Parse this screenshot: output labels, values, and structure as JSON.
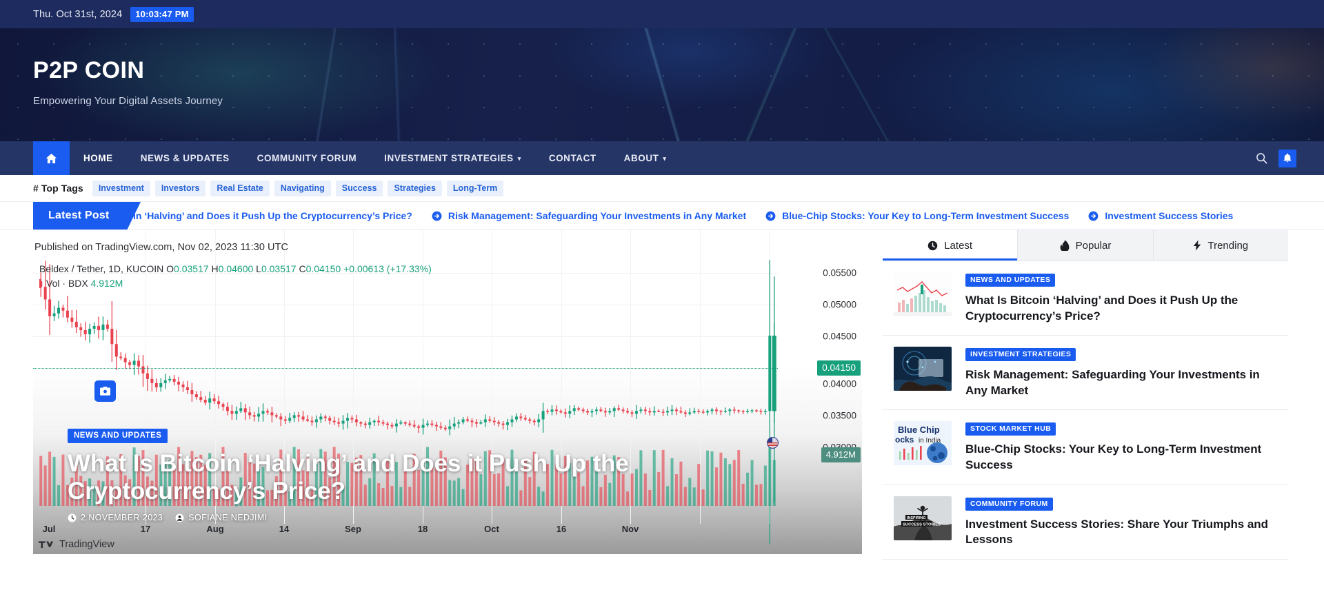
{
  "topbar": {
    "date": "Thu. Oct 31st, 2024",
    "time": "10:03:47 PM"
  },
  "banner": {
    "site_title": "P2P COIN",
    "tagline": "Empowering Your Digital Assets Journey"
  },
  "nav": {
    "home_icon": "home-icon",
    "items": [
      {
        "label": "HOME",
        "caret": "",
        "active": true
      },
      {
        "label": "NEWS & UPDATES",
        "caret": "",
        "active": false
      },
      {
        "label": "COMMUNITY FORUM",
        "caret": "",
        "active": false
      },
      {
        "label": "INVESTMENT STRATEGIES",
        "caret": "▾",
        "active": false
      },
      {
        "label": "CONTACT",
        "caret": "",
        "active": false
      },
      {
        "label": "ABOUT",
        "caret": "▾",
        "active": false
      }
    ],
    "search_icon": "search-icon",
    "bell_icon": "bell-icon"
  },
  "tags": {
    "label": "# Top Tags",
    "items": [
      "Investment",
      "Investors",
      "Real Estate",
      "Navigating",
      "Success",
      "Strategies",
      "Long-Term"
    ]
  },
  "ticker": {
    "label": "Latest Post",
    "items": [
      "Is Bitcoin ‘Halving’ and Does it Push Up the Cryptocurrency’s Price?",
      "Risk Management: Safeguarding Your Investments in Any Market",
      "Blue-Chip Stocks: Your Key to Long-Term Investment Success",
      "Investment Success Stories"
    ]
  },
  "hero": {
    "published": "Published on TradingView.com, Nov 02, 2023 11:30 UTC",
    "symbol": "Beldex / Tether, 1D, KUCOIN",
    "ohlc": {
      "o_label": "O",
      "o": "0.03517",
      "h_label": "H",
      "h": "0.04600",
      "l_label": "L",
      "l": "0.03517",
      "c_label": "C",
      "c": "0.04150",
      "change": "+0.00613",
      "change_pct": "(+17.33%)"
    },
    "volume_label": "Vol · BDX",
    "volume_value": "4.912M",
    "category": "NEWS AND UPDATES",
    "title": "What Is Bitcoin ‘Halving’ and Does it Push Up the Cryptocurrency’s Price?",
    "meta_date": "2 NOVEMBER 2023",
    "meta_author": "SOFIANE NEDJIMI",
    "brand": "TradingView",
    "camera_icon": "camera-icon"
  },
  "chart_data": {
    "type": "candlestick",
    "title": "Beldex / Tether, 1D, KUCOIN",
    "xlabel": "",
    "ylabel": "",
    "ylim": [
      0.0275,
      0.0575
    ],
    "price_ticks": [
      "0.05500",
      "0.05000",
      "0.04500",
      "0.04000",
      "0.03500",
      "0.03000"
    ],
    "price_tick_values": [
      0.055,
      0.05,
      0.045,
      0.04,
      0.035,
      0.03
    ],
    "current_price_badge": "0.04150",
    "current_price_value": 0.0415,
    "volume_badge": "4.912M",
    "time_ticks": [
      "Jul",
      "17",
      "Aug",
      "14",
      "Sep",
      "18",
      "Oct",
      "16",
      "Nov"
    ],
    "colors": {
      "up": "#17a07c",
      "down": "#e9434f",
      "price_line": "#17a07c"
    },
    "series": [
      {
        "name": "Open",
        "values": [
          0.0538,
          0.053,
          0.0512,
          0.0488,
          0.0492,
          0.05,
          0.0496,
          0.0486,
          0.048,
          0.0472,
          0.0468,
          0.0462,
          0.047,
          0.0474,
          0.0468,
          0.0476,
          0.047,
          0.0448,
          0.043,
          0.0428,
          0.0422,
          0.0418,
          0.0424,
          0.0416,
          0.0406,
          0.0398,
          0.0392,
          0.0386,
          0.0392,
          0.0396,
          0.0398,
          0.0394,
          0.039,
          0.0386,
          0.0382,
          0.0376,
          0.0372,
          0.0368,
          0.0364,
          0.037,
          0.0366,
          0.0362,
          0.0358,
          0.0352,
          0.0348,
          0.0352,
          0.0356,
          0.035,
          0.0346,
          0.0344,
          0.0348,
          0.0352,
          0.035,
          0.0346,
          0.0344,
          0.034,
          0.0338,
          0.0342,
          0.0346,
          0.0344,
          0.034,
          0.0338,
          0.0336,
          0.034,
          0.0344,
          0.0342,
          0.0338,
          0.0336,
          0.0334,
          0.0338,
          0.0342,
          0.034,
          0.0336,
          0.0334,
          0.0332,
          0.0336,
          0.0338,
          0.0336,
          0.0334,
          0.0332,
          0.033,
          0.0334,
          0.0336,
          0.0334,
          0.0332,
          0.033,
          0.0328,
          0.0332,
          0.0334,
          0.0332,
          0.033,
          0.0328,
          0.0326,
          0.033,
          0.0334,
          0.0336,
          0.034,
          0.0338,
          0.0336,
          0.0334,
          0.0336,
          0.034,
          0.0338,
          0.0336,
          0.0334,
          0.0332,
          0.0336,
          0.034,
          0.0344,
          0.0342,
          0.034,
          0.0338,
          0.0336,
          0.034,
          0.0352,
          0.0351,
          0.0354,
          0.0352,
          0.035,
          0.0348,
          0.0352,
          0.0356,
          0.0354,
          0.0352,
          0.035,
          0.0352,
          0.0354,
          0.0352,
          0.035,
          0.0352,
          0.0356,
          0.0354,
          0.0352,
          0.035,
          0.0348,
          0.0352,
          0.0354,
          0.0352,
          0.035,
          0.0352,
          0.0351,
          0.035,
          0.0352,
          0.0354,
          0.0352,
          0.035,
          0.0348,
          0.035,
          0.0352,
          0.0351,
          0.035,
          0.0352,
          0.0354,
          0.0352,
          0.0351,
          0.0352,
          0.0354,
          0.0353,
          0.0352,
          0.0351,
          0.0352,
          0.0353,
          0.0352,
          0.0351,
          0.0352,
          0.03517
        ]
      },
      {
        "name": "Close",
        "values": [
          0.053,
          0.0512,
          0.0488,
          0.0492,
          0.05,
          0.0496,
          0.0486,
          0.048,
          0.0472,
          0.0468,
          0.0462,
          0.047,
          0.0474,
          0.0468,
          0.0476,
          0.047,
          0.0448,
          0.043,
          0.0428,
          0.0422,
          0.0418,
          0.0424,
          0.0416,
          0.0406,
          0.0398,
          0.0392,
          0.0386,
          0.0392,
          0.0396,
          0.0398,
          0.0394,
          0.039,
          0.0386,
          0.0382,
          0.0376,
          0.0372,
          0.0368,
          0.0364,
          0.037,
          0.0366,
          0.0362,
          0.0358,
          0.0352,
          0.0348,
          0.0352,
          0.0356,
          0.035,
          0.0346,
          0.0344,
          0.0348,
          0.0352,
          0.035,
          0.0346,
          0.0344,
          0.034,
          0.0338,
          0.0342,
          0.0346,
          0.0344,
          0.034,
          0.0338,
          0.0336,
          0.034,
          0.0344,
          0.0342,
          0.0338,
          0.0336,
          0.0334,
          0.0338,
          0.0342,
          0.034,
          0.0336,
          0.0334,
          0.0332,
          0.0336,
          0.0338,
          0.0336,
          0.0334,
          0.0332,
          0.033,
          0.0334,
          0.0336,
          0.0334,
          0.0332,
          0.033,
          0.0328,
          0.0332,
          0.0334,
          0.0332,
          0.033,
          0.0328,
          0.0326,
          0.033,
          0.0334,
          0.0336,
          0.034,
          0.0338,
          0.0336,
          0.0334,
          0.0336,
          0.034,
          0.0338,
          0.0336,
          0.0334,
          0.0332,
          0.0336,
          0.034,
          0.0344,
          0.0342,
          0.034,
          0.0338,
          0.0336,
          0.034,
          0.0352,
          0.0351,
          0.0354,
          0.0352,
          0.035,
          0.0348,
          0.0352,
          0.0356,
          0.0354,
          0.0352,
          0.035,
          0.0352,
          0.0354,
          0.0352,
          0.035,
          0.0352,
          0.0356,
          0.0354,
          0.0352,
          0.035,
          0.0348,
          0.0352,
          0.0354,
          0.0352,
          0.035,
          0.0352,
          0.0351,
          0.035,
          0.0352,
          0.0354,
          0.0352,
          0.035,
          0.0348,
          0.035,
          0.0352,
          0.0351,
          0.035,
          0.0352,
          0.0354,
          0.0352,
          0.0351,
          0.0352,
          0.0354,
          0.0353,
          0.0352,
          0.0351,
          0.0352,
          0.0353,
          0.0352,
          0.0351,
          0.0352,
          0.046,
          0.0415
        ]
      }
    ]
  },
  "sidebar": {
    "tabs": [
      {
        "label": "Latest",
        "icon": "clock-icon",
        "active": true
      },
      {
        "label": "Popular",
        "icon": "flame-icon",
        "active": false
      },
      {
        "label": "Trending",
        "icon": "bolt-icon",
        "active": false
      }
    ],
    "posts": [
      {
        "category": "NEWS AND UPDATES",
        "title": "What Is Bitcoin ‘Halving’ and Does it Push Up the Cryptocurrency’s Price?",
        "thumb": "chart-thumb"
      },
      {
        "category": "INVESTMENT STRATEGIES",
        "title": "Risk Management: Safeguarding Your Investments in Any Market",
        "thumb": "tech-thumb"
      },
      {
        "category": "STOCK MARKET HUB",
        "title": "Blue-Chip Stocks: Your Key to Long-Term Investment Success",
        "thumb": "bluechip-thumb"
      },
      {
        "category": "COMMUNITY FORUM",
        "title": "Investment Success Stories: Share Your Triumphs and Lessons",
        "thumb": "success-thumb"
      }
    ]
  },
  "colors": {
    "topbar_bg": "#1d2b5e",
    "nav_bg": "#253566",
    "accent": "#1a5cf0",
    "up": "#17a07c",
    "down": "#e9434f"
  }
}
